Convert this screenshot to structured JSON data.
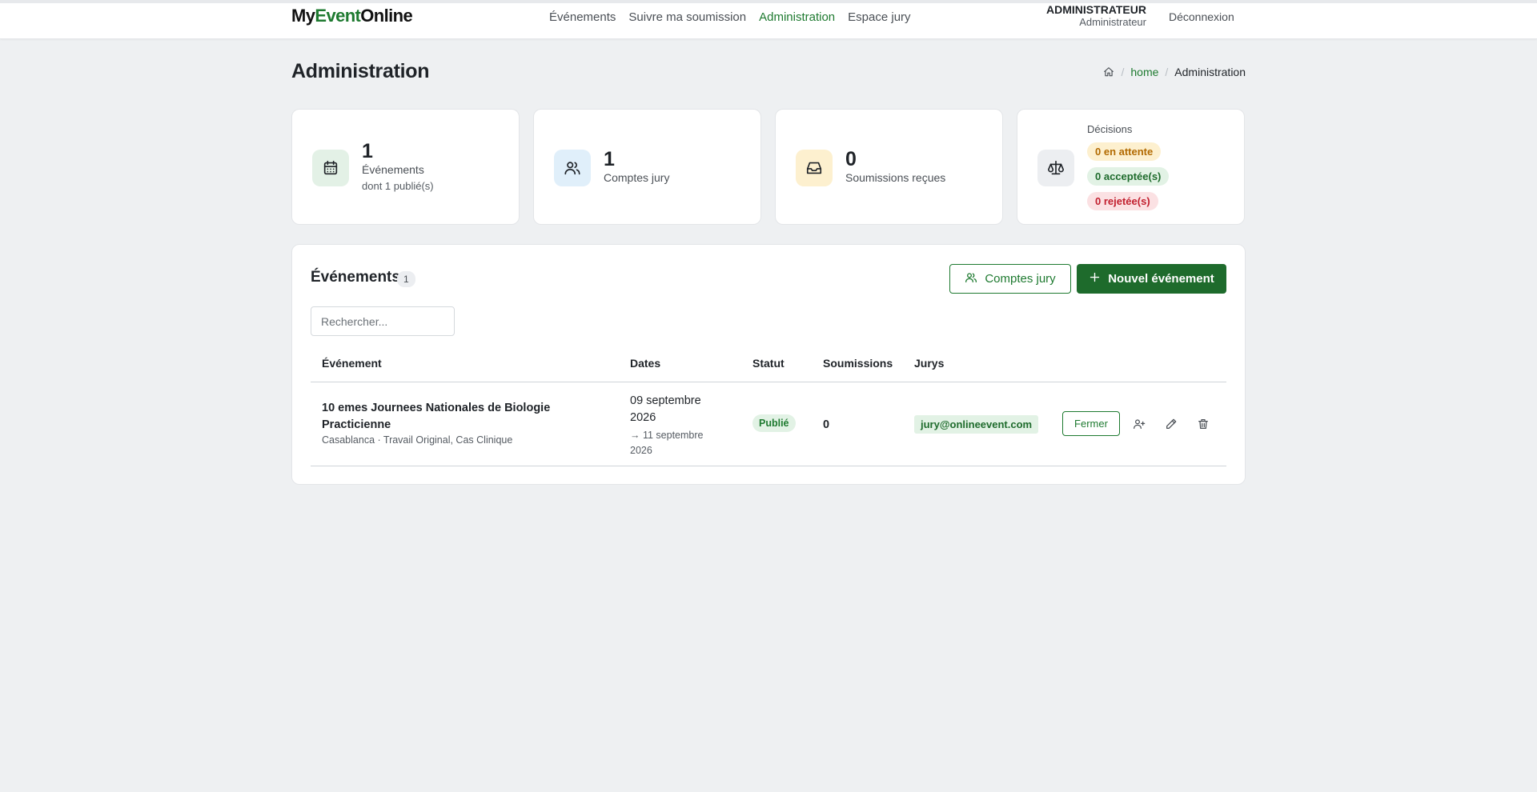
{
  "brand": {
    "part1": "My",
    "part2": "Event",
    "part3": "Online"
  },
  "nav": [
    {
      "label": "Événements",
      "active": false
    },
    {
      "label": "Suivre ma soumission",
      "active": false
    },
    {
      "label": "Administration",
      "active": true
    },
    {
      "label": "Espace jury",
      "active": false
    }
  ],
  "user": {
    "name": "ADMINISTRATEUR",
    "role": "Administrateur",
    "logout": "Déconnexion"
  },
  "page": {
    "title": "Administration",
    "breadcrumb": {
      "home": "home",
      "current": "Administration"
    }
  },
  "stats": {
    "events": {
      "value": "1",
      "label": "Événements",
      "hint": "dont 1 publié(s)"
    },
    "jury": {
      "value": "1",
      "label": "Comptes jury"
    },
    "submissions": {
      "value": "0",
      "label": "Soumissions reçues"
    },
    "decisions": {
      "label": "Décisions",
      "pending": "0 en attente",
      "accepted": "0 acceptée(s)",
      "rejected": "0 rejetée(s)"
    }
  },
  "events_panel": {
    "title": "Événements",
    "count": "1",
    "jury_button": "Comptes jury",
    "new_button": "Nouvel événement",
    "search_placeholder": "Rechercher...",
    "columns": [
      "Événement",
      "Dates",
      "Statut",
      "Soumissions",
      "Jurys"
    ],
    "rows": [
      {
        "title": "10 emes Journees Nationales de Biologie Practicienne",
        "subtitle": "Casablanca · Travail Original, Cas Clinique",
        "date_start": "09 septembre 2026",
        "date_end": "→ 11 septembre 2026",
        "status": "Publié",
        "submissions": "0",
        "jury": "jury@onlineevent.com",
        "close_button": "Fermer"
      }
    ]
  },
  "colors": {
    "accent": "#1e7a30",
    "primary_button": "#1e6b2c",
    "page_bg": "#eef0f2",
    "pending_bg": "#fdf0cf",
    "pending_text": "#b26a00",
    "accepted_bg": "#e2f2e5",
    "rejected_bg": "#fbe1e3",
    "rejected_text": "#c2202f"
  },
  "icons": {
    "events": "calendar-icon",
    "jury": "users-icon",
    "submissions": "inbox-icon",
    "decisions": "scale-icon",
    "row_actions": [
      "user-plus-icon",
      "pencil-icon",
      "trash-icon"
    ]
  }
}
